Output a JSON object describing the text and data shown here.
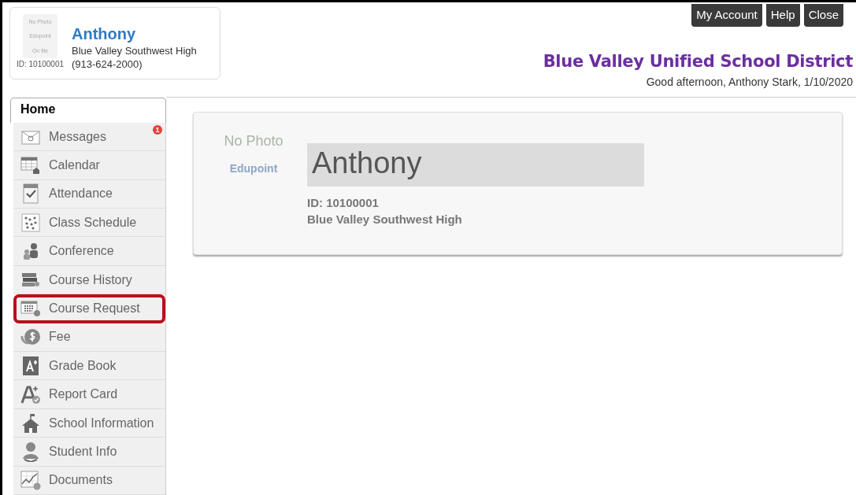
{
  "profile_card": {
    "photo_placeholder": [
      "No Photo",
      "Edupoint",
      "On file"
    ],
    "id": "ID: 10100001",
    "name": "Anthony",
    "school": "Blue Valley Southwest High",
    "phone": "(913-624-2000)"
  },
  "header_buttons": [
    "My Account",
    "Help",
    "Close"
  ],
  "district": "Blue Valley Unified School District",
  "greeting": "Good afternoon, Anthony Stark, 1/10/2020",
  "home_tab": {
    "label": "Home",
    "selected": true
  },
  "sidebar": {
    "items": [
      {
        "label": "Messages",
        "badge": "1",
        "highlighted": false
      },
      {
        "label": "Calendar",
        "highlighted": false
      },
      {
        "label": "Attendance",
        "highlighted": false
      },
      {
        "label": "Class Schedule",
        "highlighted": false
      },
      {
        "label": "Conference",
        "highlighted": false
      },
      {
        "label": "Course History",
        "highlighted": false
      },
      {
        "label": "Course Request",
        "highlighted": true
      },
      {
        "label": "Fee",
        "highlighted": false
      },
      {
        "label": "Grade Book",
        "highlighted": false
      },
      {
        "label": "Report Card",
        "highlighted": false
      },
      {
        "label": "School Information",
        "highlighted": false
      },
      {
        "label": "Student Info",
        "highlighted": false
      },
      {
        "label": "Documents",
        "highlighted": false
      }
    ]
  },
  "student_card": {
    "photo_placeholder": [
      "No Photo",
      "Edupoint"
    ],
    "name": "Anthony",
    "id": "ID: 10100001",
    "school": "Blue Valley Southwest High"
  }
}
